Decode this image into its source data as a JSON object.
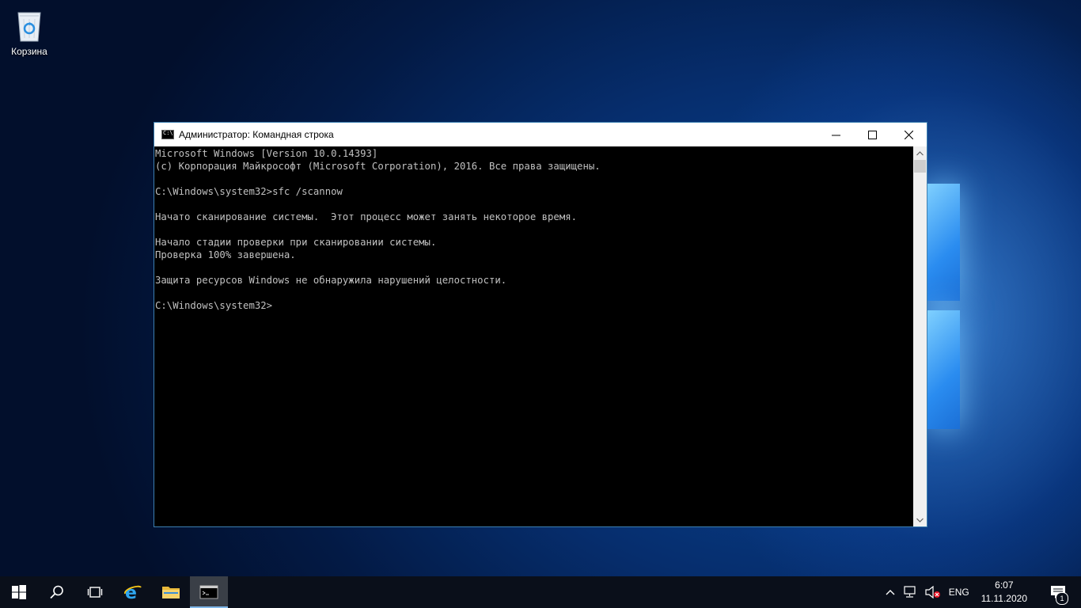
{
  "desktop": {
    "recycle_bin_label": "Корзина"
  },
  "window": {
    "title": "Администратор: Командная строка",
    "console_lines": [
      "Microsoft Windows [Version 10.0.14393]",
      "(c) Корпорация Майкрософт (Microsoft Corporation), 2016. Все права защищены.",
      "",
      "C:\\Windows\\system32>sfc /scannow",
      "",
      "Начато сканирование системы.  Этот процесс может занять некоторое время.",
      "",
      "Начало стадии проверки при сканировании системы.",
      "Проверка 100% завершена.",
      "",
      "Защита ресурсов Windows не обнаружила нарушений целостности.",
      "",
      "C:\\Windows\\system32>"
    ]
  },
  "taskbar": {
    "language": "ENG",
    "time": "6:07",
    "date": "11.11.2020",
    "notification_count": "1"
  },
  "colors": {
    "console_bg": "#000000",
    "console_text": "#c0c0c0",
    "taskbar_bg": "#0a0f1a",
    "window_border": "#3c7fb1"
  }
}
